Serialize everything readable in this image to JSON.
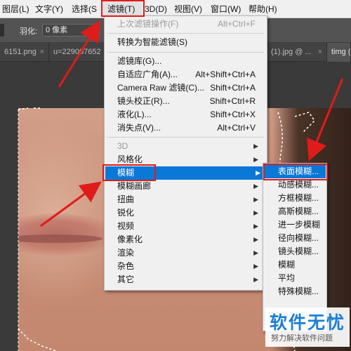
{
  "menubar": {
    "items": [
      {
        "label": "图层(L)"
      },
      {
        "label": "文字(Y)"
      },
      {
        "label": "选择(S"
      },
      {
        "label": "滤镜(T)"
      },
      {
        "label": "3D(D)"
      },
      {
        "label": "视图(V)"
      },
      {
        "label": "窗口(W)"
      },
      {
        "label": "帮助(H)"
      }
    ]
  },
  "options": {
    "feather_label": "羽化:",
    "feather_value": "0 像素"
  },
  "tabs": [
    {
      "label": "6151.png"
    },
    {
      "label": "u=229007652"
    },
    {
      "label": "(1).jpg @ ..."
    },
    {
      "label": "timg ("
    }
  ],
  "filter_menu": {
    "items": [
      {
        "label": "上次滤镜操作(F)",
        "shortcut": "Alt+Ctrl+F"
      },
      {
        "label": "转换为智能滤镜(S)"
      },
      {
        "label": "滤镜库(G)..."
      },
      {
        "label": "自适应广角(A)...",
        "shortcut": "Alt+Shift+Ctrl+A"
      },
      {
        "label": "Camera Raw 滤镜(C)...",
        "shortcut": "Shift+Ctrl+A"
      },
      {
        "label": "镜头校正(R)...",
        "shortcut": "Shift+Ctrl+R"
      },
      {
        "label": "液化(L)...",
        "shortcut": "Shift+Ctrl+X"
      },
      {
        "label": "消失点(V)...",
        "shortcut": "Alt+Ctrl+V"
      },
      {
        "label": "3D"
      },
      {
        "label": "风格化"
      },
      {
        "label": "模糊"
      },
      {
        "label": "模糊画廊"
      },
      {
        "label": "扭曲"
      },
      {
        "label": "锐化"
      },
      {
        "label": "视频"
      },
      {
        "label": "像素化"
      },
      {
        "label": "渲染"
      },
      {
        "label": "杂色"
      },
      {
        "label": "其它"
      }
    ]
  },
  "blur_submenu": {
    "items": [
      {
        "label": "表面模糊..."
      },
      {
        "label": "动感模糊..."
      },
      {
        "label": "方框模糊..."
      },
      {
        "label": "高斯模糊..."
      },
      {
        "label": "进一步模糊"
      },
      {
        "label": "径向模糊..."
      },
      {
        "label": "镜头模糊..."
      },
      {
        "label": "模糊"
      },
      {
        "label": "平均"
      },
      {
        "label": "特殊模糊..."
      }
    ]
  },
  "watermark": {
    "title": "软件无忧",
    "subtitle": "努力解决软件问题"
  },
  "colors": {
    "highlight": "#0a78d7",
    "annotation_red": "#e01b1b",
    "watermark_blue": "#1a7fd6"
  }
}
